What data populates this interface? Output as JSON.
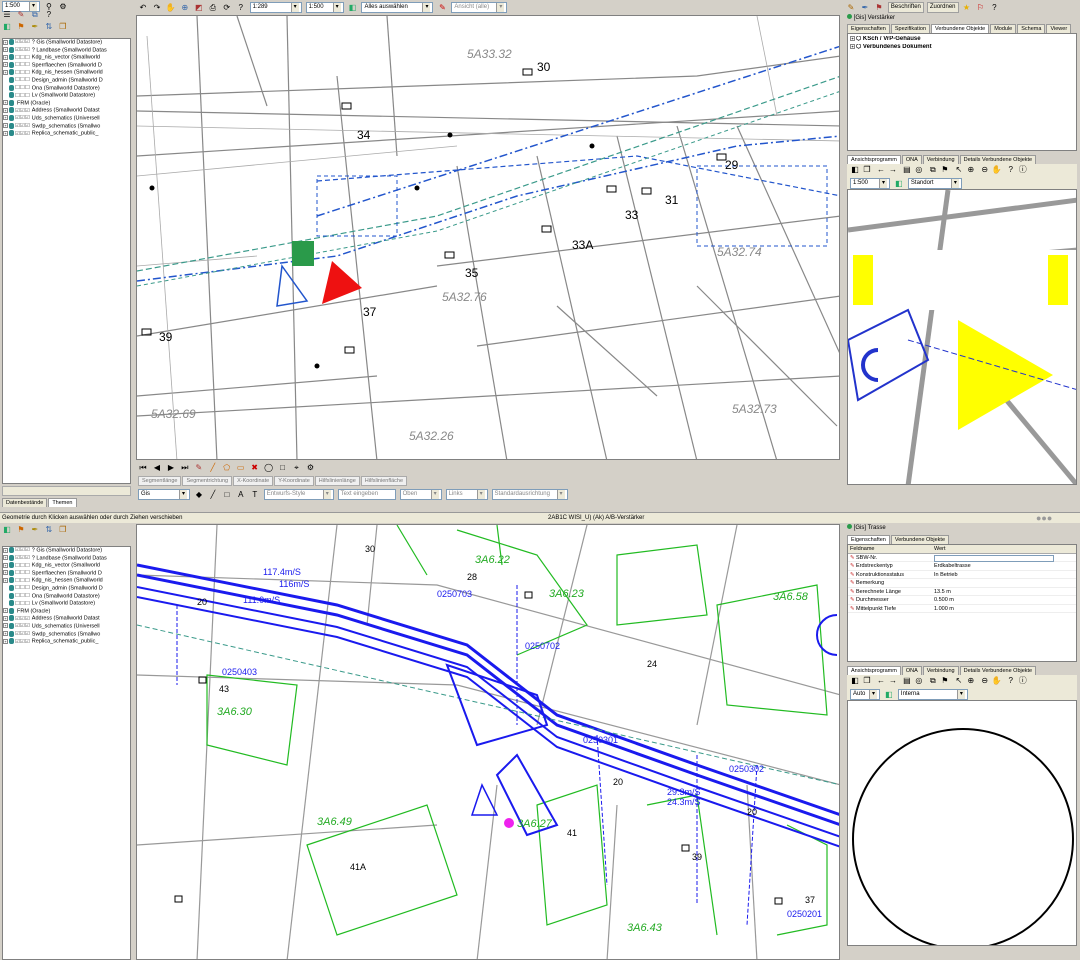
{
  "top_left": {
    "scale_combo": "1:500",
    "tree": [
      {
        "pm": "+",
        "chk": "☑☑☑",
        "label": "? Gis (Smallworld Datastore)"
      },
      {
        "pm": "+",
        "chk": "☑☑☑",
        "label": "? Landbase (Smallworld Datas"
      },
      {
        "pm": "+",
        "chk": "☐☐☐",
        "label": "Kdg_nis_vector (Smallworld"
      },
      {
        "pm": "+",
        "chk": "☐☐☐",
        "label": "Sperrflaechen (Smallworld D"
      },
      {
        "pm": "+",
        "chk": "☐☐☐",
        "label": "Kdg_nis_hessen (Smallworld"
      },
      {
        "pm": "",
        "chk": "☐☐☐",
        "label": "Design_admin (Smallworld D"
      },
      {
        "pm": "",
        "chk": "☐☐☐",
        "label": "Ona (Smallworld Datastore)"
      },
      {
        "pm": "",
        "chk": "☐☐☐",
        "label": "Lv (Smallworld Datastore)"
      },
      {
        "pm": "+",
        "chk": "",
        "label": "FRM (Oracle)"
      },
      {
        "pm": "+",
        "chk": "☑☑☑",
        "label": "Address (Smallworld Datast"
      },
      {
        "pm": "+",
        "chk": "☑☑☑",
        "label": "Uds_schematics (Universell"
      },
      {
        "pm": "+",
        "chk": "☑☑☑",
        "label": "Swdp_schematics (Smallwo"
      },
      {
        "pm": "+",
        "chk": "☑☑☑",
        "label": "Replica_schematic_public_"
      }
    ],
    "tabs": [
      "Datenbestände",
      "Themen"
    ]
  },
  "bottom_left": {
    "tree": [
      {
        "pm": "+",
        "chk": "☑☑☑",
        "label": "? Gis (Smallworld Datastore)"
      },
      {
        "pm": "+",
        "chk": "☑☑☑",
        "label": "? Landbase (Smallworld Datas"
      },
      {
        "pm": "+",
        "chk": "☐☐☐",
        "label": "Kdg_nis_vector (Smallworld"
      },
      {
        "pm": "+",
        "chk": "☐☐☐",
        "label": "Sperrflaechen (Smallworld D"
      },
      {
        "pm": "+",
        "chk": "☐☐☐",
        "label": "Kdg_nis_hessen (Smallworld"
      },
      {
        "pm": "",
        "chk": "☐☐☐",
        "label": "Design_admin (Smallworld D"
      },
      {
        "pm": "",
        "chk": "☐☐☐",
        "label": "Ona (Smallworld Datastore)"
      },
      {
        "pm": "",
        "chk": "☐☐☐",
        "label": "Lv (Smallworld Datastore)"
      },
      {
        "pm": "+",
        "chk": "",
        "label": "FRM (Oracle)"
      },
      {
        "pm": "+",
        "chk": "☑☑☑",
        "label": "Address (Smallworld Datast"
      },
      {
        "pm": "+",
        "chk": "☑☑☑",
        "label": "Uds_schematics (Universell"
      },
      {
        "pm": "+",
        "chk": "☑☑☑",
        "label": "Swdp_schematics (Smallwo"
      },
      {
        "pm": "+",
        "chk": "☑☑☑",
        "label": "Replica_schematic_public_"
      }
    ]
  },
  "main_toolbar": {
    "scale1": "1:289",
    "scale2": "1:500",
    "select_all": "Alles auswählen",
    "view_all": "Ansicht (alle)"
  },
  "edit_toolbar": {
    "fields": [
      "Segmentlänge",
      "Segmentrichtung",
      "X-Koordinate",
      "Y-Koordinate",
      "Hilfslinienlänge",
      "Hilfslinienfläche"
    ],
    "layer": "Gis",
    "style": "Entwurfs-Style",
    "text_placeholder": "Text eingeben",
    "pos1": "Oben",
    "pos2": "Links",
    "align": "Standardausrichtung"
  },
  "status_top": "Geometrie durch Klicken auswählen oder durch Ziehen verschieben",
  "status_title": "2AB1C WISI_U) (Ak) A/B-Verstärker",
  "top_right": {
    "buttons": [
      "Beschriften",
      "Zuordnen"
    ],
    "object_title": "[Gis] Verstärker",
    "tabs": [
      "Eigenschaften",
      "Spezifikation",
      "Verbundene Objekte",
      "Module",
      "Schema",
      "Viewer"
    ],
    "items": [
      "KSch / VrP-Gehäuse",
      "Verbundenes Dokument"
    ]
  },
  "viewer1": {
    "tabs": [
      "Ansichtsprogramm",
      "ONA",
      "Verbindung",
      "Details Verbundene Objekte"
    ],
    "scale": "1:500",
    "location": "Standort"
  },
  "props": {
    "title": "[Gis] Trasse",
    "tabs": [
      "Eigenschaften",
      "Verbundene Objekte"
    ],
    "col_name": "Feldname",
    "col_value": "Wert",
    "rows": [
      {
        "name": "SBW-Nr.",
        "value": ""
      },
      {
        "name": "Erdstreckentyp",
        "value": "Erdkabeltrasse"
      },
      {
        "name": "Konstruktionsstatus",
        "value": "In Betrieb"
      },
      {
        "name": "Bemerkung",
        "value": ""
      },
      {
        "name": "Berechnete Länge",
        "value": "13.5 m"
      },
      {
        "name": "Durchmesser",
        "value": "0.500 m"
      },
      {
        "name": "Mittelpunkt Tiefe",
        "value": "1.000 m"
      }
    ]
  },
  "viewer2": {
    "tabs": [
      "Ansichtsprogramm",
      "ONA",
      "Verbindung",
      "Details Verbundene Objekte"
    ],
    "scale": "Auto",
    "location": "Interna"
  },
  "map_top_labels": {
    "n30": "30",
    "n34": "34",
    "n29": "29",
    "n31": "31",
    "n33": "33",
    "n33a": "33A",
    "n35": "35",
    "n37": "37",
    "n39": "39",
    "p1": "5A32.74",
    "p2": "5A32.76",
    "p3": "5A32.69",
    "p4": "5A32.26",
    "p5": "5A32.73",
    "p6": "5A33.32"
  },
  "map_bottom_labels": {
    "n30": "30",
    "n28": "28",
    "n24": "24",
    "n43": "43",
    "n41": "41",
    "n41a": "41A",
    "n39": "39",
    "n37": "37",
    "n20a": "20",
    "n20b": "20",
    "n20c": "20",
    "p1": "3A6.22",
    "p2": "3A6.23",
    "p3": "3A6.30",
    "p4": "3A6.49",
    "p5": "3A6.27",
    "p6": "3A6.43",
    "p7": "3A6.58",
    "c1": "0250703",
    "c2": "0250702",
    "c3": "0250403",
    "c4": "0250301",
    "c5": "0250302",
    "c6": "0250201",
    "s1": "117.4m/S",
    "s2": "116m/S",
    "s3": "111.0m/S",
    "s4": "29.3m/S",
    "s5": "24.3m/S"
  }
}
